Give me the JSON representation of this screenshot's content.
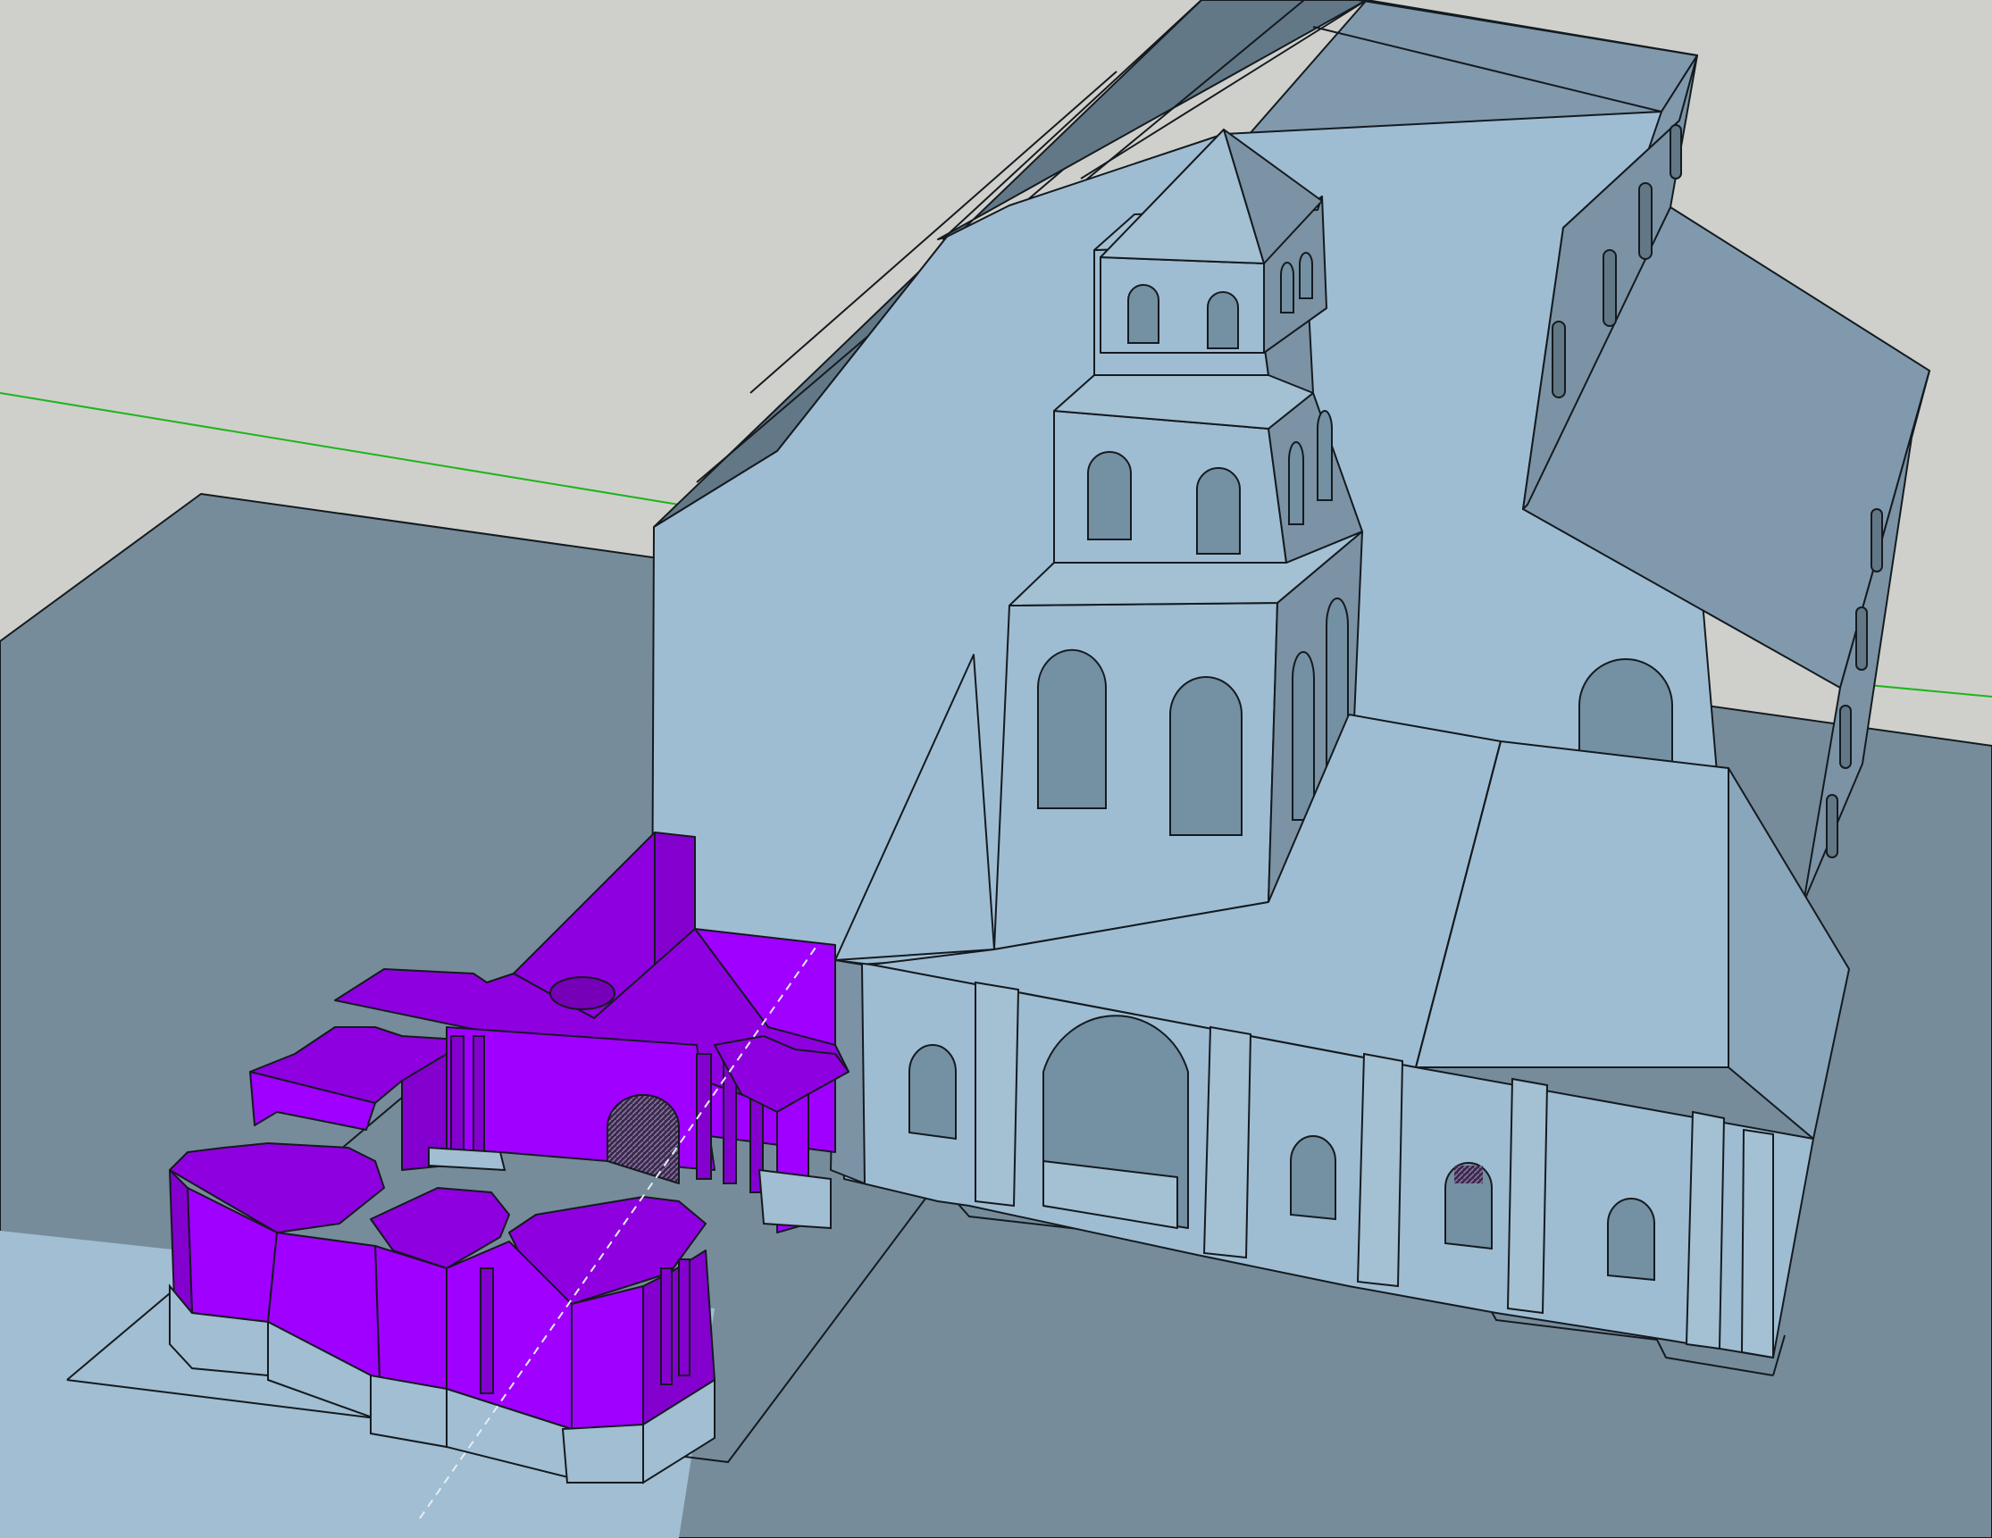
{
  "app": {
    "kind": "3d-modeling-viewport",
    "view": "perspective"
  },
  "colors": {
    "sky": "#cfd0cb",
    "ground": "#768c9a",
    "wall_light": "#9fbdd2",
    "wall_mid": "#89a6bb",
    "wall_shadow": "#7b93a4",
    "roof": "#8099ad",
    "roof_dark": "#637886",
    "opening": "#7490a3",
    "selected_face": "#a000ff",
    "selected_dark": "#8400cf",
    "selected_top": "#8f00e0",
    "axis_green": "#1eb41e",
    "edge": "#141a1f"
  },
  "icons": {
    "green_axis": "axis-green-line-icon",
    "guide": "guide-dashed-line-icon"
  }
}
